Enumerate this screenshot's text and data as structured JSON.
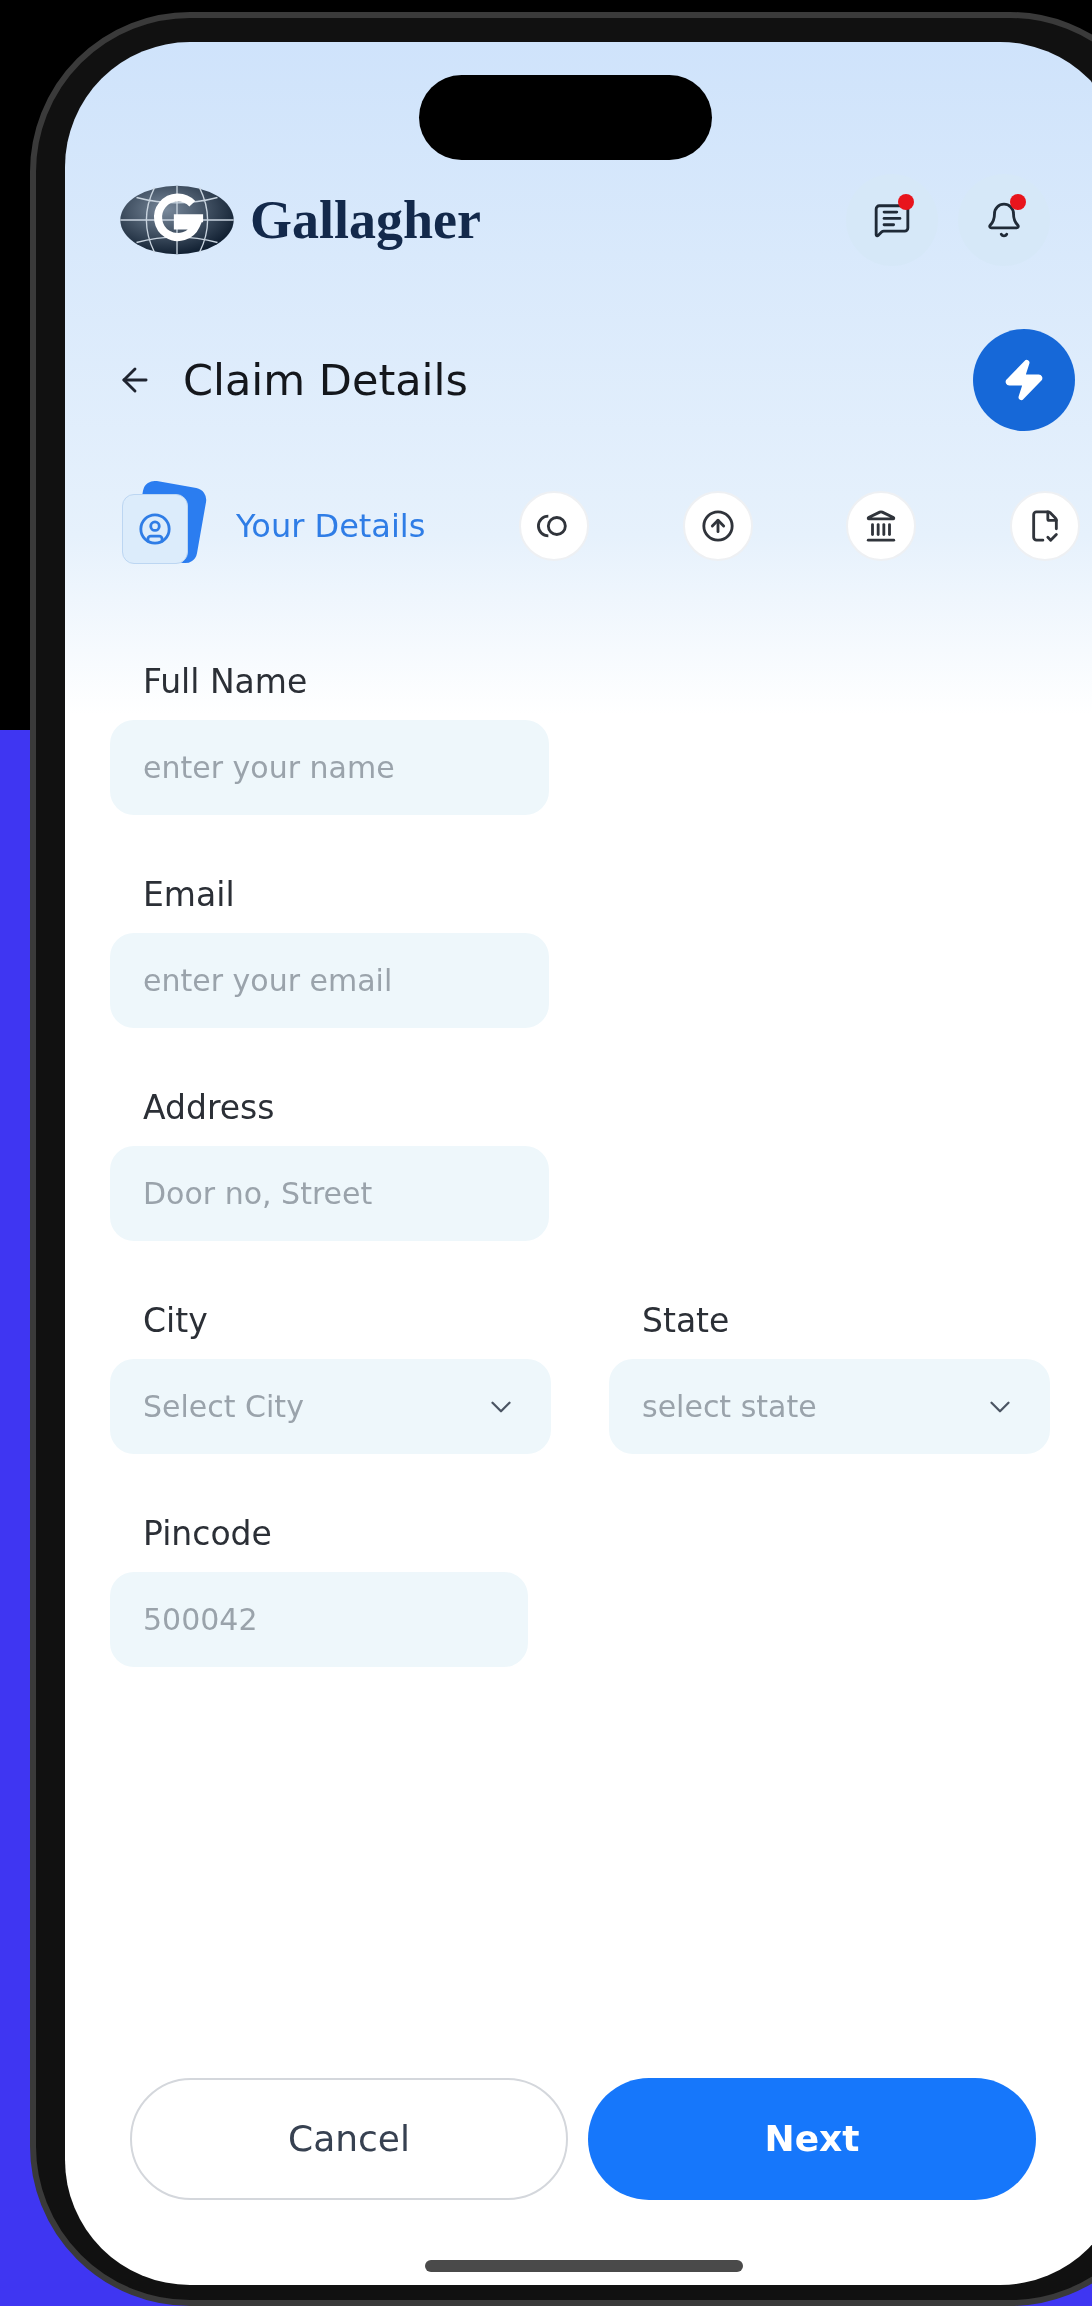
{
  "header": {
    "brand": "Gallagher",
    "actions": [
      {
        "kind": "chat",
        "unread": true
      },
      {
        "kind": "bell",
        "unread": true
      }
    ]
  },
  "title_bar": {
    "title": "Claim Details"
  },
  "steps": [
    {
      "kind": "person",
      "label": "Your Details",
      "selected": true
    },
    {
      "kind": "coins",
      "selected": false
    },
    {
      "kind": "upload",
      "selected": false
    },
    {
      "kind": "bank",
      "selected": false
    },
    {
      "kind": "checklist",
      "selected": false
    }
  ],
  "form": {
    "rows": [
      [
        {
          "kind": "text",
          "label": "Full Name",
          "placeholder": "enter your name"
        }
      ],
      [
        {
          "kind": "text",
          "label": "Email",
          "placeholder": "enter your email"
        }
      ],
      [
        {
          "kind": "text",
          "label": "Address",
          "placeholder": "Door no, Street"
        }
      ],
      [
        {
          "kind": "select",
          "label": "City",
          "placeholder": "Select City"
        },
        {
          "kind": "select",
          "label": "State",
          "placeholder": "select state"
        }
      ],
      [
        {
          "kind": "short",
          "label": "Pincode",
          "placeholder": "500042"
        }
      ]
    ]
  },
  "buttons": [
    {
      "kind": "secondary",
      "label": "Cancel"
    },
    {
      "kind": "primary",
      "label": "Next"
    }
  ]
}
